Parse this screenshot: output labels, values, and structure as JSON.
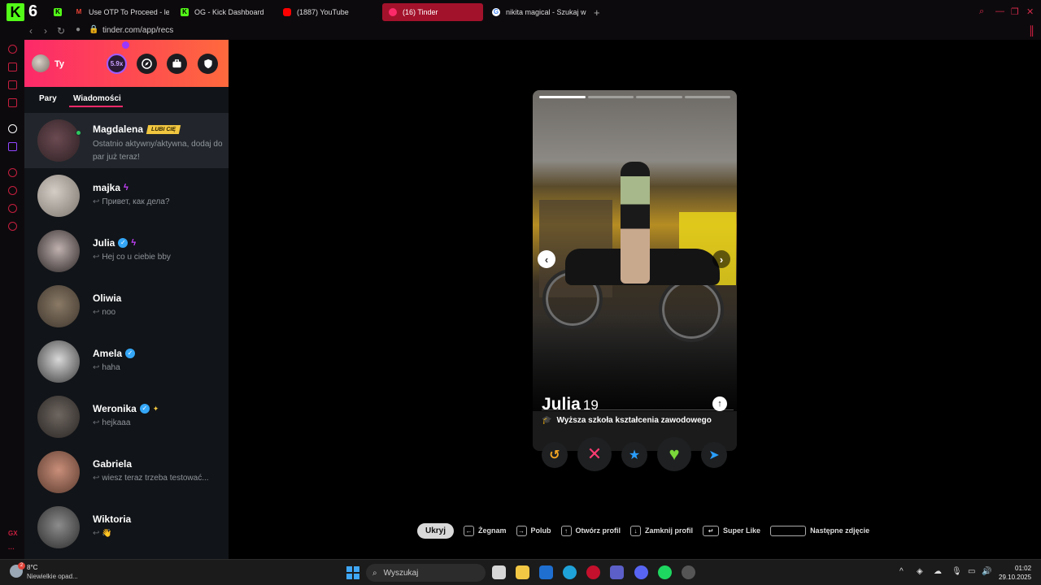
{
  "browser": {
    "tabs": [
      {
        "label": "Use OTP To Proceed - lee",
        "favicon": "gmail-icon",
        "color": "#ea4335"
      },
      {
        "label": "OG - Kick Dashboard",
        "favicon": "kick-icon",
        "color": "#53fc18"
      },
      {
        "label": "(1887) YouTube",
        "favicon": "youtube-icon",
        "color": "#ff0000"
      },
      {
        "label": "(16) Tinder",
        "favicon": "tinder-icon",
        "color": "#fd2a6a"
      },
      {
        "label": "nikita magical - Szukaj w",
        "favicon": "google-icon",
        "color": "#4285f4"
      }
    ],
    "url": "tinder.com/app/recs"
  },
  "sidebar": {
    "me": {
      "name": "Ty"
    },
    "boost_label": "5.9x",
    "tabs": {
      "matches": "Pary",
      "messages": "Wiadomości"
    },
    "active_match": {
      "name": "Magdalena",
      "badge": "LUBI CIĘ",
      "text": "Ostatnio aktywny/aktywna, dodaj do par już teraz!"
    },
    "messages": [
      {
        "name": "majka",
        "preview": "Привет, как дела?"
      },
      {
        "name": "Julia",
        "preview": "Hej co u ciebie bby"
      },
      {
        "name": "Oliwia",
        "preview": "noo"
      },
      {
        "name": "Amela",
        "preview": "haha"
      },
      {
        "name": "Weronika",
        "preview": "hejkaaa"
      },
      {
        "name": "Gabriela",
        "preview": "wiesz teraz trzeba testować..."
      },
      {
        "name": "Wiktoria",
        "preview": "👋"
      }
    ]
  },
  "card": {
    "name": "Julia",
    "age": "19",
    "school": "Wyższa szkoła kształcenia zawodowego",
    "photos_total": 4,
    "photo_current": 1
  },
  "shortcuts": {
    "hide": "Ukryj",
    "nope": "Żegnam",
    "like": "Polub",
    "open_profile": "Otwórz profil",
    "close_profile": "Zamknij profil",
    "super_like": "Super Like",
    "next_photo": "Następne zdjęcie"
  },
  "taskbar": {
    "weather_temp": "8°C",
    "weather_desc": "Niewielkie opad...",
    "weather_badge": "2",
    "search_placeholder": "Wyszukaj",
    "time": "01:02",
    "date": "29.10.2025"
  },
  "colors": {
    "tinder_accent": "#fd2a6a",
    "nope": "#fe3c72",
    "like": "#7ad83a",
    "super": "#2a9dfb",
    "rewind": "#f5a623",
    "boost": "#a05cff"
  }
}
